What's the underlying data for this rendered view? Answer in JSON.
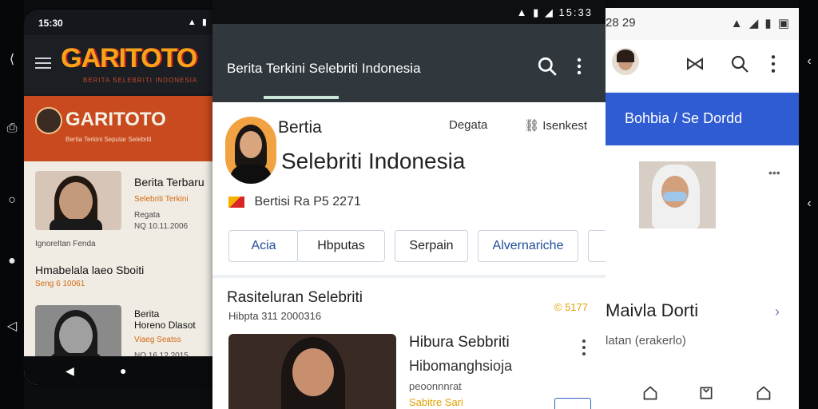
{
  "system_nav": {
    "left_buttons": [
      "⟨",
      "⎙",
      "○",
      "●",
      "◁"
    ],
    "right_buttons": [
      "‹",
      "‹"
    ]
  },
  "left_phone": {
    "status": {
      "time": "15:30",
      "icons": "▲ ▮ ▮"
    },
    "app": {
      "logo": "GARITOTO",
      "logo_subtitle": "BERITA SELEBRITI INDONESIA",
      "banner_title": "GARITOTO",
      "banner_subtitle": "Berita Terkini Seputar Selebriti"
    },
    "cards": [
      {
        "title": "Berita Terbaru",
        "source": "Selebriti Terkini",
        "category": "Regata",
        "date": "NQ 10.11.2006",
        "footer": "Ignoreltan Fenda"
      },
      {
        "title": "Hmabelala laeo Sboiti",
        "source": "Seng 6 10061"
      },
      {
        "title": "Berita",
        "subtitle": "Horeno Dlasot",
        "source": "Viaeg Seatss",
        "date": "NQ 16.12.2015"
      }
    ]
  },
  "middle_phone": {
    "status": {
      "icons": "▲ ▮ ◢ 15:33"
    },
    "appbar": {
      "title": "Berita Terkini Selebriti Indonesia"
    },
    "profile": {
      "name_line1": "Bertia",
      "name_line2": "Selebriti Indonesia",
      "action1": "Degata",
      "action2": "Isenkest",
      "meta": "Bertisi Ra P5 2271"
    },
    "chips": [
      "Acia",
      "Hbputas",
      "Serpain",
      "Alvernariche"
    ],
    "section": {
      "title": "Rasiteluran Selebriti",
      "subtitle": "Hibpta 311 2000316",
      "badge": "© 5177"
    },
    "card": {
      "title": "Hibura Sebbriti",
      "subtitle": "Hibomanghsioja",
      "extra": "peoonnnrat",
      "source": "Sabitre Sari"
    }
  },
  "right_phone": {
    "status": {
      "left": "28 29",
      "right": "▲ ◢ ▮ ▣"
    },
    "banner": {
      "text": "Bohbia / Se Dordd"
    },
    "item": {
      "title": "Maivla Dorti",
      "subtitle": "latan (erakerlo)",
      "more": "•••"
    }
  }
}
